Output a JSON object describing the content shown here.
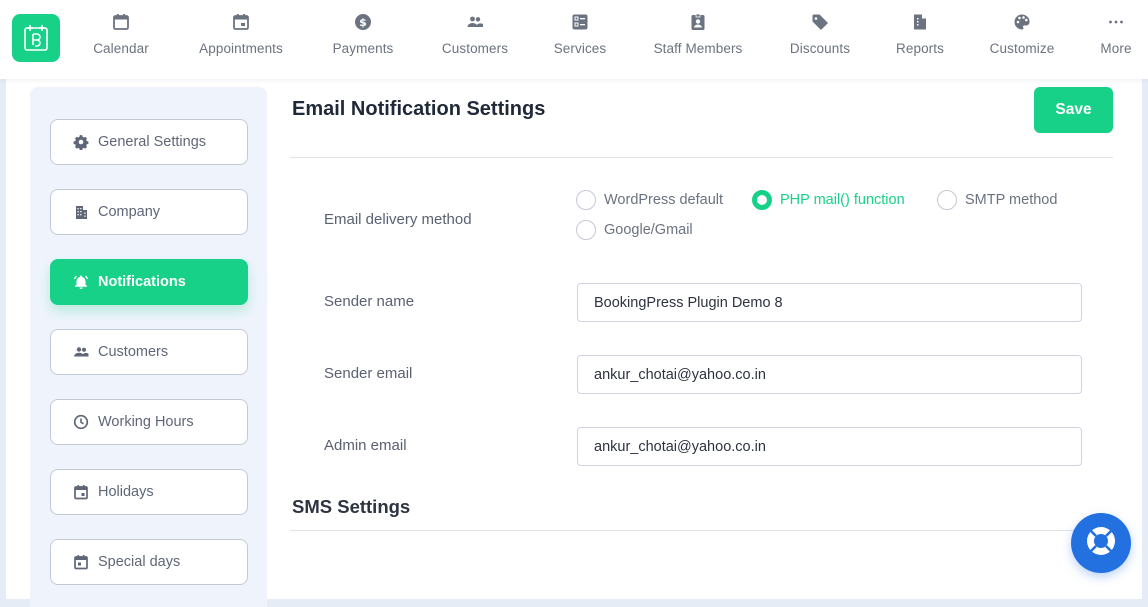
{
  "app": {
    "logo_icon": "bookingpress-logo-icon",
    "brand_color": "#18d189",
    "help_color": "#2370e0"
  },
  "nav": [
    {
      "label": "Calendar",
      "icon": "calendar-icon"
    },
    {
      "label": "Appointments",
      "icon": "calendar-day-icon"
    },
    {
      "label": "Payments",
      "icon": "dollar-circle-icon"
    },
    {
      "label": "Customers",
      "icon": "users-icon"
    },
    {
      "label": "Services",
      "icon": "services-icon"
    },
    {
      "label": "Staff Members",
      "icon": "id-badge-icon"
    },
    {
      "label": "Discounts",
      "icon": "tag-icon"
    },
    {
      "label": "Reports",
      "icon": "report-icon"
    },
    {
      "label": "Customize",
      "icon": "palette-icon"
    },
    {
      "label": "More",
      "icon": "more-icon"
    }
  ],
  "sidebar": {
    "items": [
      {
        "label": "General Settings",
        "icon": "gear-icon",
        "active": false
      },
      {
        "label": "Company",
        "icon": "building-icon",
        "active": false
      },
      {
        "label": "Notifications",
        "icon": "bell-icon",
        "active": true
      },
      {
        "label": "Customers",
        "icon": "users-icon",
        "active": false
      },
      {
        "label": "Working Hours",
        "icon": "clock-icon",
        "active": false
      },
      {
        "label": "Holidays",
        "icon": "calendar-icon",
        "active": false
      },
      {
        "label": "Special days",
        "icon": "calendar-day-icon",
        "active": false
      }
    ]
  },
  "main": {
    "title": "Email Notification Settings",
    "save_label": "Save",
    "delivery": {
      "label": "Email delivery method",
      "options": [
        "WordPress default",
        "PHP mail() function",
        "SMTP method",
        "Google/Gmail"
      ],
      "selected": "PHP mail() function"
    },
    "sender_name": {
      "label": "Sender name",
      "value": "BookingPress Plugin Demo 8"
    },
    "sender_email": {
      "label": "Sender email",
      "value": "ankur_chotai@yahoo.co.in"
    },
    "admin_email": {
      "label": "Admin email",
      "value": "ankur_chotai@yahoo.co.in"
    },
    "sms_title": "SMS Settings"
  },
  "help_icon": "lifebuoy-icon"
}
